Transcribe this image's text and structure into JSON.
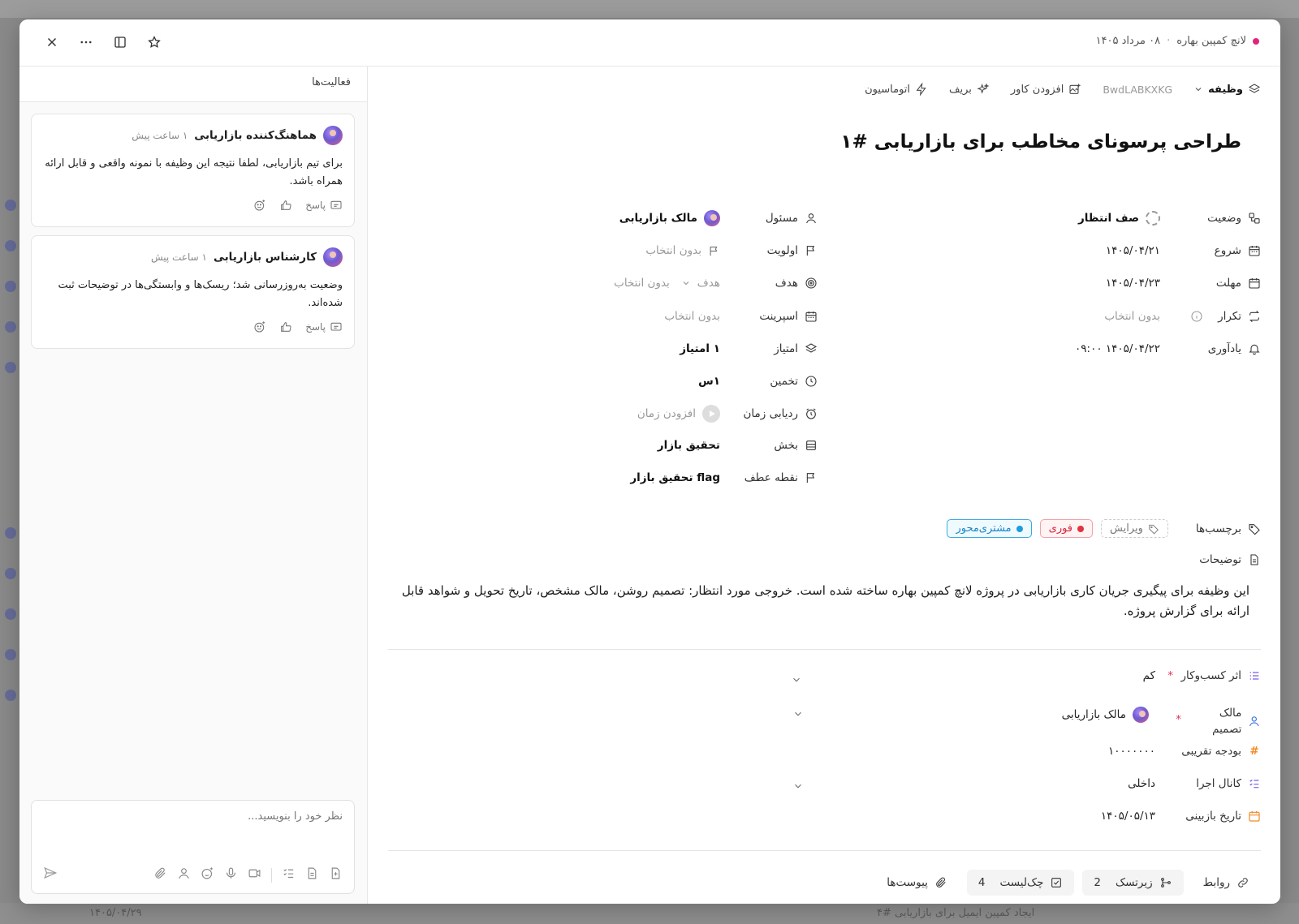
{
  "background": {
    "bottom_texts": [
      "۱۴۰۵/۰۴/۲۹",
      "ایجاد کمپین ایمیل برای بازاریابی #۴"
    ]
  },
  "header": {
    "project": "لانچ کمپین بهاره",
    "date": "۰۸ مرداد ۱۴۰۵",
    "accent_color": "#e0257a"
  },
  "activity": {
    "title": "فعالیت‌ها",
    "items": [
      {
        "author": "هماهنگ‌کننده بازاریابی",
        "time": "۱ ساعت پیش",
        "text": "برای تیم بازاریابی، لطفا نتیجه این وظیفه با نمونه واقعی و قابل ارائه همراه باشد.",
        "reply": "پاسخ"
      },
      {
        "author": "کارشناس بازاریابی",
        "time": "۱ ساعت پیش",
        "text": "وضعیت به‌روزرسانی شد؛ ریسک‌ها و وابستگی‌ها در توضیحات ثبت شده‌اند.",
        "reply": "پاسخ"
      }
    ],
    "composer_placeholder": "نظر خود را بنویسید..."
  },
  "toolbar": {
    "type": "وظیفه",
    "code": "BwdLABKXKG",
    "add_cover": "افزودن کاور",
    "brief": "بریف",
    "automation": "اتوماسیون"
  },
  "task": {
    "title": "طراحی پرسونای مخاطب برای بازاریابی #۱"
  },
  "props_right": {
    "status": {
      "label": "وضعیت",
      "value": "صف انتظار"
    },
    "start": {
      "label": "شروع",
      "value": "۱۴۰۵/۰۴/۲۱"
    },
    "due": {
      "label": "مهلت",
      "value": "۱۴۰۵/۰۴/۲۳"
    },
    "repeat": {
      "label": "تکرار",
      "value": "بدون انتخاب"
    },
    "reminder": {
      "label": "یادآوری",
      "value": "۱۴۰۵/۰۴/۲۲ ۰۹:۰۰"
    }
  },
  "props_left": {
    "assignee": {
      "label": "مسئول",
      "value": "مالک بازاریابی"
    },
    "priority": {
      "label": "اولویت",
      "value": "بدون انتخاب"
    },
    "goal": {
      "label": "هدف",
      "select": "هدف",
      "value": "بدون انتخاب"
    },
    "sprint": {
      "label": "اسپرینت",
      "value": "بدون انتخاب"
    },
    "points": {
      "label": "امتیاز",
      "value": "۱ امتیاز"
    },
    "estimate": {
      "label": "تخمین",
      "value": "۱س"
    },
    "time_tracking": {
      "label": "ردیابی زمان",
      "value": "افزودن زمان"
    },
    "section": {
      "label": "بخش",
      "value": "تحقیق بازار"
    },
    "milestone": {
      "label": "نقطه عطف",
      "value": "flag تحقیق بازار"
    }
  },
  "tags": {
    "label": "برچسب‌ها",
    "edit": "ویرایش",
    "items": [
      {
        "name": "فوری",
        "color": "#e5323f"
      },
      {
        "name": "مشتری‌محور",
        "color": "#1f9be0"
      }
    ]
  },
  "description": {
    "label": "توضیحات",
    "text": "این وظیفه برای پیگیری جریان کاری بازاریابی در پروژه لانچ کمپین بهاره ساخته شده است. خروجی مورد انتظار: تصمیم روشن، مالک مشخص، تاریخ تحویل و شواهد قابل ارائه برای گزارش پروژه."
  },
  "custom_fields": [
    {
      "label": "اثر کسب‌وکار",
      "value": "کم",
      "required": true,
      "icon_color": "#7c5cf0"
    },
    {
      "label": "مالک تصمیم",
      "value": "مالک بازاریابی",
      "required": true,
      "icon_color": "#3b6fe0"
    },
    {
      "label": "بودجه تقریبی",
      "value": "۱۰۰۰۰۰۰۰",
      "required": false,
      "icon_color": "#f08a24"
    },
    {
      "label": "کانال اجرا",
      "value": "داخلی",
      "required": false,
      "icon_color": "#7c5cf0"
    },
    {
      "label": "تاریخ بازبینی",
      "value": "۱۴۰۵/۰۵/۱۳",
      "required": false,
      "icon_color": "#f08a24"
    }
  ],
  "bottom_bar": {
    "relations": "روابط",
    "subtasks": "زیرتسک",
    "subtasks_count": "2",
    "checklist": "چک‌لیست",
    "checklist_count": "4",
    "attachments": "پیوست‌ها"
  }
}
